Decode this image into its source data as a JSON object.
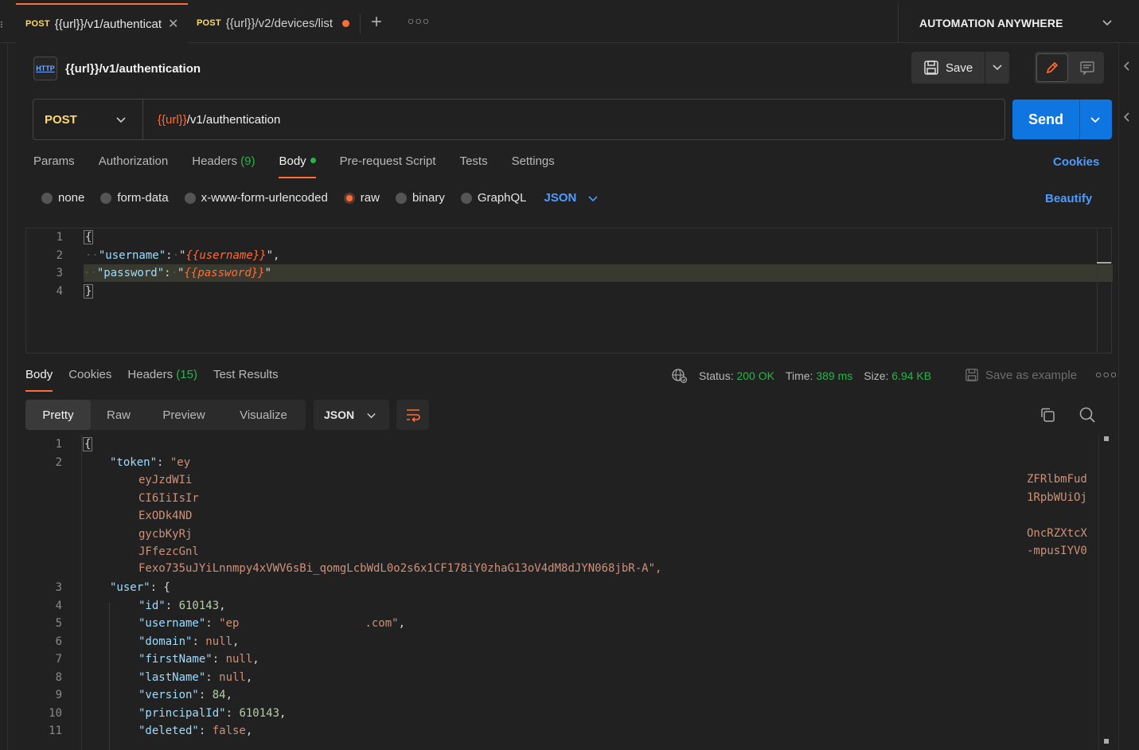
{
  "tabs": [
    {
      "method": "POST",
      "label": "{{url}}/v1/authenticat",
      "active": true
    },
    {
      "method": "POST",
      "label": "{{url}}/v2/devices/list",
      "unsaved": true
    }
  ],
  "workspace": {
    "name": "AUTOMATION ANYWHERE"
  },
  "request": {
    "icon_text": "HTTP",
    "name": "{{url}}/v1/authentication",
    "save_label": "Save",
    "method": "POST",
    "url_var": "{{url}}",
    "url_path": "/v1/authentication",
    "send_label": "Send",
    "tabs": [
      "Params",
      "Authorization",
      "Headers",
      "Body",
      "Pre-request Script",
      "Tests",
      "Settings"
    ],
    "headers_count": "(9)",
    "cookies_label": "Cookies",
    "body_types": [
      "none",
      "form-data",
      "x-www-form-urlencoded",
      "raw",
      "binary",
      "GraphQL"
    ],
    "body_lang": "JSON",
    "beautify_label": "Beautify",
    "body_lines": {
      "ln": [
        "1",
        "2",
        "3",
        "4"
      ],
      "open": "{",
      "key1": "\"username\"",
      "val1": "\"{{username}}\"",
      "key2": "\"password\"",
      "val2": "\"{{password}}\"",
      "close": "}"
    }
  },
  "response": {
    "tabs": [
      "Body",
      "Cookies",
      "Headers",
      "Test Results"
    ],
    "headers_count": "(15)",
    "status_label": "Status:",
    "status_value": "200 OK",
    "time_label": "Time:",
    "time_value": "389 ms",
    "size_label": "Size:",
    "size_value": "6.94 KB",
    "save_example_label": "Save as example",
    "views": [
      "Pretty",
      "Raw",
      "Preview",
      "Visualize"
    ],
    "format": "JSON",
    "lines": {
      "ln": [
        "1",
        "2",
        "3",
        "4",
        "5",
        "6",
        "7",
        "8",
        "9",
        "10",
        "11"
      ],
      "open": "{",
      "token_key": "\"token\"",
      "token_start": "\"ey",
      "token_frag_left": [
        "eyJzdWIi",
        "CI6IiIsIr",
        "ExODk4ND",
        "gycbKyRj",
        "JFfezcGnl"
      ],
      "token_frag_right": [
        "ZFRlbmFud",
        "1RpbWUiOj",
        "",
        "OncRZXtcX",
        "-mpusIYV0"
      ],
      "token_last": "Fexo735uJYiLnnmpy4xVWV6sBi_qomgLcbWdL0o2s6x1CF178iY0zhaG13oV4dM8dJYN068jbR-A\",",
      "user_key": "\"user\"",
      "id_key": "\"id\"",
      "id_val": "610143",
      "username_key": "\"username\"",
      "username_val_start": "\"ep",
      "username_val_end": ".com\"",
      "domain_key": "\"domain\"",
      "domain_val": "null",
      "firstName_key": "\"firstName\"",
      "firstName_val": "null",
      "lastName_key": "\"lastName\"",
      "lastName_val": "null",
      "version_key": "\"version\"",
      "version_val": "84",
      "principalId_key": "\"principalId\"",
      "principalId_val": "610143",
      "deleted_key": "\"deleted\"",
      "deleted_val": "false"
    }
  },
  "colors": {
    "accent": "#ff6c37",
    "send": "#0f75e0",
    "link": "#4d9bff",
    "success": "#2ab24b",
    "method": "#ffd96a"
  }
}
